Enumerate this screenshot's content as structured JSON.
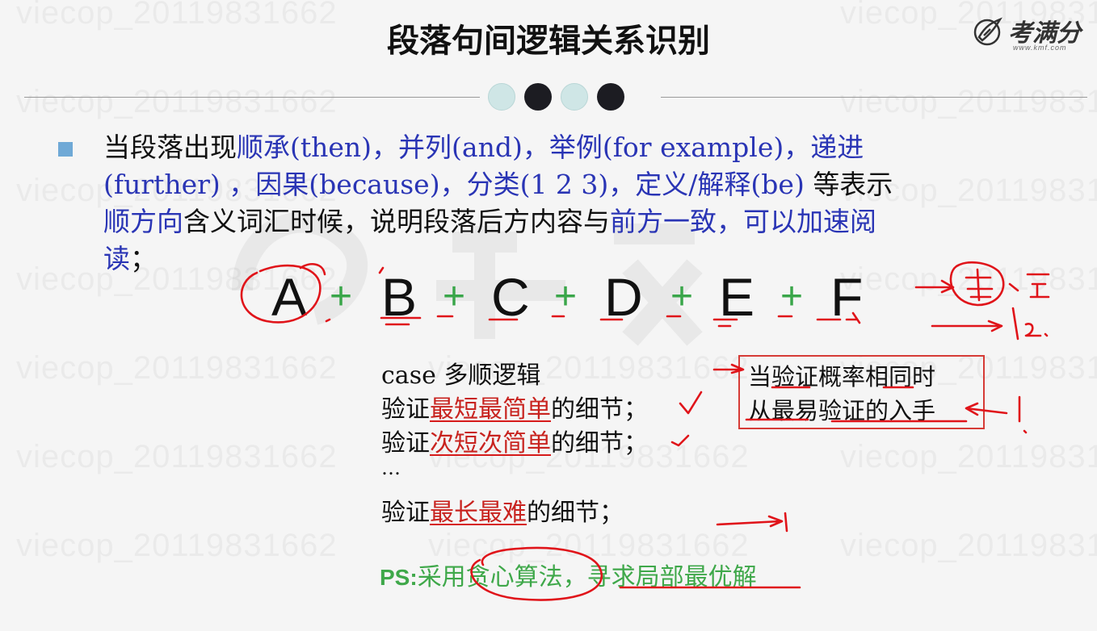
{
  "slide": {
    "title": "段落句间逻辑关系识别",
    "logo": {
      "text": "考满分",
      "url": "www.kmf.com"
    },
    "watermark": "viecop_20119831662"
  },
  "paragraph": {
    "segments": [
      {
        "text": "当段落出现",
        "color": "black"
      },
      {
        "text": "顺承(then)，并列(and)，举例(for example)，递进",
        "color": "blue"
      },
      {
        "text": "(further) ，因果(because)，分类(1 2 3)，定义/解释(be)",
        "color": "blue"
      },
      {
        "text": " 等表示",
        "color": "black"
      },
      {
        "text": "顺方向",
        "color": "blue"
      },
      {
        "text": "含义词汇时候，说明段落后方内容与",
        "color": "black"
      },
      {
        "text": "前方一致，可以加速阅",
        "color": "blue"
      },
      {
        "text": "读",
        "color": "blue"
      },
      {
        "text": "；",
        "color": "black"
      }
    ]
  },
  "formula": {
    "terms": [
      "A",
      "B",
      "C",
      "D",
      "E",
      "F"
    ],
    "operator": "+"
  },
  "case": {
    "heading": "case 多顺逻辑",
    "rows": [
      {
        "prefix": "验证",
        "red1": "最短",
        "red2": "最简单",
        "suffix": "的细节；"
      },
      {
        "prefix": "验证",
        "red1": "次短",
        "red2": "次简单",
        "suffix": "的细节；"
      },
      {
        "ellipsis": "…"
      },
      {
        "prefix": "验证",
        "red1": "最长",
        "red2": "最难",
        "suffix": "的细节；"
      }
    ]
  },
  "note": {
    "line1": "当验证概率相同时",
    "line2": "从最易验证的入手"
  },
  "ps": {
    "label": "PS:",
    "text": "采用贪心算法，寻求局部最优解"
  },
  "colors": {
    "blue_text": "#2a35b5",
    "red_text": "#c8231f",
    "green_text": "#3fa84a",
    "bullet": "#6fa9d6",
    "annotation_ink": "#e0141a"
  }
}
